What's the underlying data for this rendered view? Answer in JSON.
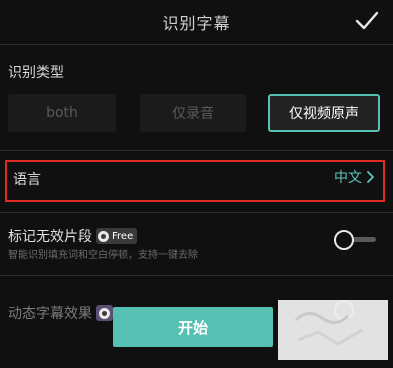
{
  "header": {
    "title": "识别字幕",
    "confirm_icon": "checkmark-icon"
  },
  "recognition_type": {
    "label": "识别类型",
    "options": [
      "both",
      "仅录音",
      "仅视频原声"
    ],
    "selected": "仅视频原声"
  },
  "language": {
    "label": "语言",
    "value": "中文"
  },
  "mark_invalid": {
    "title": "标记无效片段",
    "badge": "Free",
    "description": "智能识别填充词和空白停顿，支持一键去除",
    "enabled": false
  },
  "dynamic_subtitle": {
    "title": "动态字幕效果"
  },
  "start_button": {
    "label": "开始"
  },
  "colors": {
    "accent": "#56c0b3",
    "highlight_border": "#e02a24",
    "background": "#101010"
  }
}
